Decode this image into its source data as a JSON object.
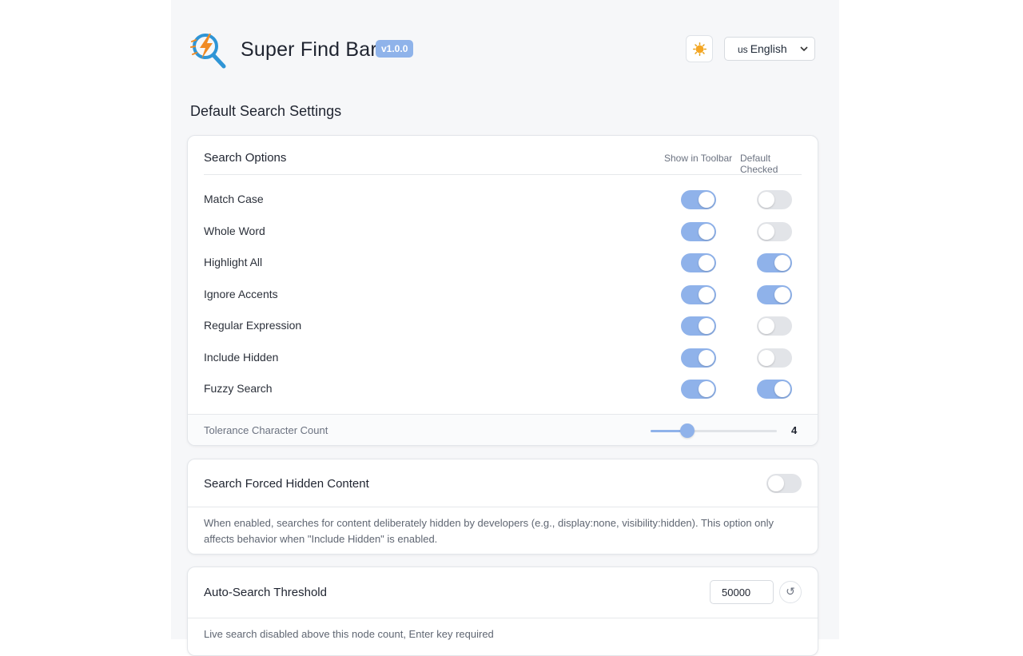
{
  "app": {
    "title": "Super Find Bar",
    "version": "v1.0.0"
  },
  "header": {
    "theme_icon": "sun-icon",
    "language": {
      "flag": "us",
      "selected": "English"
    }
  },
  "section": {
    "title": "Default Search Settings"
  },
  "search_options": {
    "title": "Search Options",
    "col_toolbar": "Show in Toolbar",
    "col_default": "Default Checked",
    "items": [
      {
        "label": "Match Case",
        "toolbar": true,
        "default": false
      },
      {
        "label": "Whole Word",
        "toolbar": true,
        "default": false
      },
      {
        "label": "Highlight All",
        "toolbar": true,
        "default": true
      },
      {
        "label": "Ignore Accents",
        "toolbar": true,
        "default": true
      },
      {
        "label": "Regular Expression",
        "toolbar": true,
        "default": false
      },
      {
        "label": "Include Hidden",
        "toolbar": true,
        "default": false
      },
      {
        "label": "Fuzzy Search",
        "toolbar": true,
        "default": true
      }
    ],
    "tolerance": {
      "label": "Tolerance Character Count",
      "value": "4",
      "fraction": 0.29
    }
  },
  "forced_hidden": {
    "title": "Search Forced Hidden Content",
    "enabled": false,
    "description": "When enabled, searches for content deliberately hidden by developers (e.g., display:none, visibility:hidden). This option only affects behavior when \"Include Hidden\" is enabled."
  },
  "threshold": {
    "title": "Auto-Search Threshold",
    "value": "50000",
    "reset_glyph": "↺",
    "description": "Live search disabled above this node count, Enter key required"
  },
  "colors": {
    "accent": "#8fb2ea",
    "toggle_off": "#e2e4e8",
    "page_bg": "#f6f7f9"
  }
}
